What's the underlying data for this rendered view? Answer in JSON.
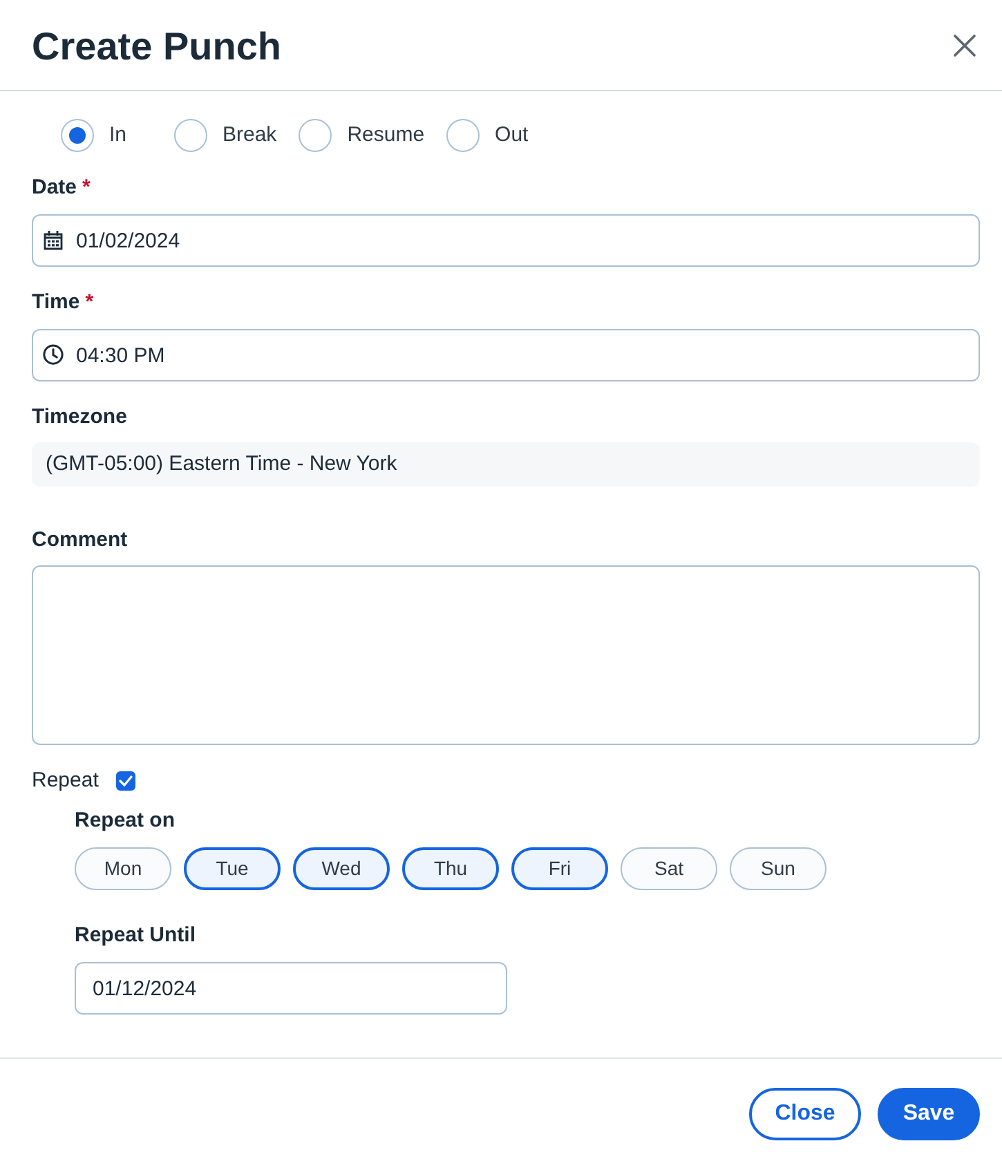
{
  "dialog": {
    "title": "Create Punch"
  },
  "punch_types": [
    {
      "label": "In",
      "selected": true
    },
    {
      "label": "Break",
      "selected": false
    },
    {
      "label": "Resume",
      "selected": false
    },
    {
      "label": "Out",
      "selected": false
    }
  ],
  "fields": [
    {
      "kind": "date",
      "label": "Date",
      "required_mark": "*",
      "value": "01/02/2024"
    },
    {
      "kind": "time",
      "label": "Time",
      "required_mark": "*",
      "value": "04:30 PM"
    },
    {
      "kind": "readonly",
      "label": "Timezone",
      "value": "(GMT-05:00) Eastern Time - New York"
    },
    {
      "kind": "textarea",
      "label": "Comment"
    }
  ],
  "repeat": {
    "label": "Repeat",
    "checked": true,
    "repeat_on_label": "Repeat on",
    "days": [
      {
        "label": "Mon",
        "selected": false
      },
      {
        "label": "Tue",
        "selected": true
      },
      {
        "label": "Wed",
        "selected": true
      },
      {
        "label": "Thu",
        "selected": true
      },
      {
        "label": "Fri",
        "selected": true
      },
      {
        "label": "Sat",
        "selected": false
      },
      {
        "label": "Sun",
        "selected": false
      }
    ],
    "until_label": "Repeat Until",
    "until_value": "01/12/2024"
  },
  "buttons": [
    {
      "label": "Close",
      "kind": "outline"
    },
    {
      "label": "Save",
      "kind": "primary"
    }
  ]
}
